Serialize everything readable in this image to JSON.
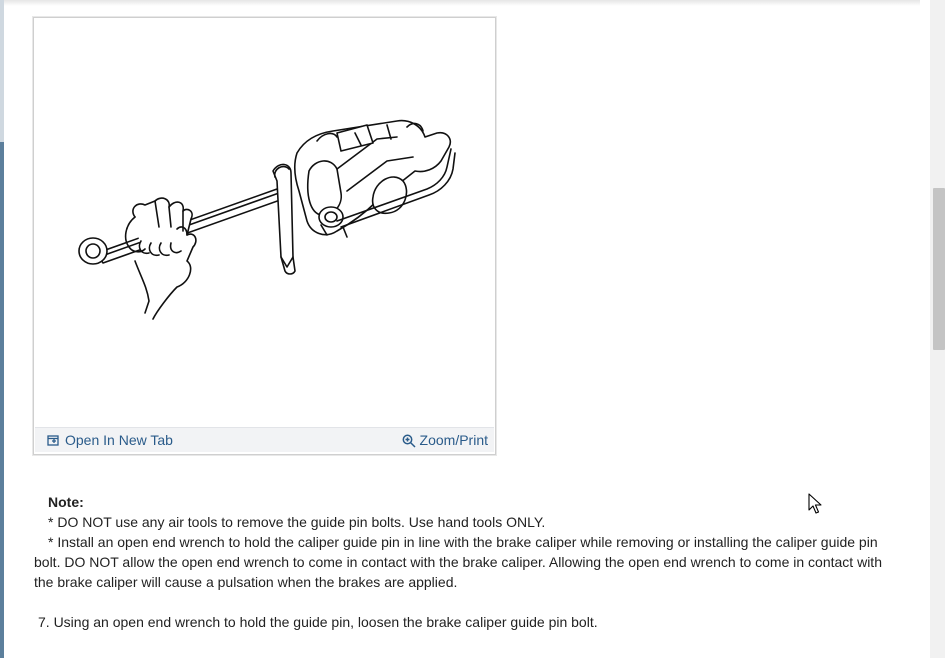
{
  "figure": {
    "image_name": "brake-caliper-guide-pin-illustration",
    "open_new_tab_label": "Open In New Tab",
    "zoom_print_label": "Zoom/Print"
  },
  "note": {
    "title": "Note:",
    "bullet_1": "*  DO NOT use any air tools to remove the guide pin bolts. Use hand tools ONLY.",
    "bullet_2": "*  Install an open end wrench to hold the caliper guide pin in line with the brake caliper while removing or installing the caliper guide pin bolt. DO NOT allow the open end wrench to come in contact with the brake caliper. Allowing the open end wrench to come in contact with the brake caliper will cause a pulsation when the brakes are applied."
  },
  "step": {
    "text": "7. Using an open end wrench to hold the guide pin, loosen the brake caliper guide pin bolt."
  },
  "colors": {
    "link": "#2a5b8a",
    "text": "#222222",
    "bar_background": "#f2f3f5"
  }
}
